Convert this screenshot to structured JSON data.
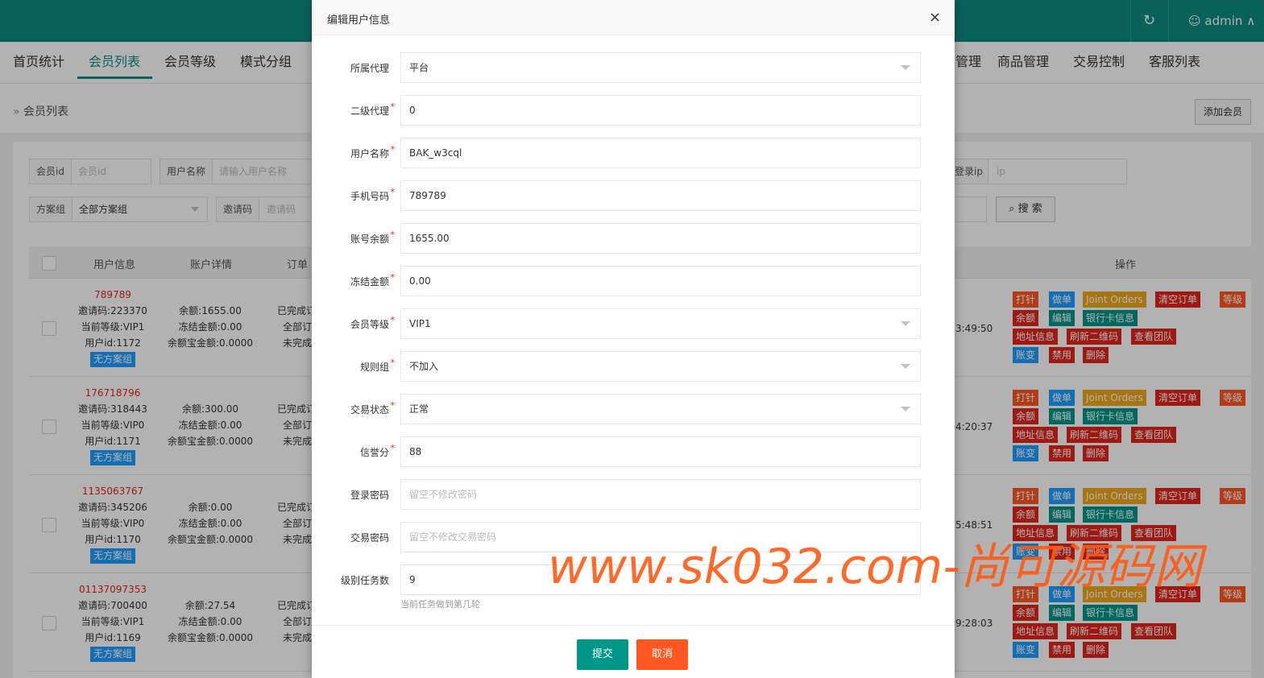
{
  "header": {
    "refresh_icon": "refresh-icon",
    "user": "admin"
  },
  "nav": {
    "items": [
      "首页统计",
      "会员列表",
      "会员等级",
      "模式分组",
      "管理",
      "商品管理",
      "交易控制",
      "客服列表"
    ]
  },
  "breadcrumb": {
    "sep": "»",
    "text": "会员列表",
    "add_button": "添加会员"
  },
  "filters": {
    "member_id": {
      "label": "会员id",
      "placeholder": "会员id"
    },
    "username": {
      "label": "用户名称",
      "placeholder": "请输入用户名称"
    },
    "login_ip": {
      "label": "登录ip",
      "placeholder": "ip"
    },
    "plan_group": {
      "label": "方案组",
      "value": "全部方案组"
    },
    "invite": {
      "label": "邀请码",
      "placeholder": "邀请码"
    },
    "search_button": "搜 索"
  },
  "table": {
    "headers": {
      "user": "用户信息",
      "account": "账户详情",
      "order": "订单",
      "ops": "操作"
    },
    "rows": [
      {
        "phone": "789789",
        "invite": "邀请码:223370",
        "level": "当前等级:VIP1",
        "uid": "用户id:1172",
        "tag": "无方案组",
        "balance": "余额:1655.00",
        "frozen": "冻结金额:0.00",
        "yeb": "余额宝金额:0.0000",
        "o1": "已完成订",
        "o2": "全部订",
        "o3": "未完成",
        "time": "3:49:50"
      },
      {
        "phone": "176718796",
        "invite": "邀请码:318443",
        "level": "当前等级:VIP0",
        "uid": "用户id:1171",
        "tag": "无方案组",
        "balance": "余额:300.00",
        "frozen": "冻结金额:0.00",
        "yeb": "余额宝金额:0.0000",
        "o1": "已完成订",
        "o2": "全部订",
        "o3": "未完成",
        "time": "4:20:37"
      },
      {
        "phone": "1135063767",
        "invite": "邀请码:345206",
        "level": "当前等级:VIP0",
        "uid": "用户id:1170",
        "tag": "无方案组",
        "balance": "余额:0.00",
        "frozen": "冻结金额:0.00",
        "yeb": "余额宝金额:0.0000",
        "o1": "已完成订",
        "o2": "全部订",
        "o3": "未完成",
        "time": "5:48:51"
      },
      {
        "phone": "01137097353",
        "invite": "邀请码:700400",
        "level": "当前等级:VIP1",
        "uid": "用户id:1169",
        "tag": "无方案组",
        "balance": "余额:27.54",
        "frozen": "冻结金额:0.00",
        "yeb": "余额宝金额:0.0000",
        "o1": "已完成订",
        "o2": "全部订",
        "o3": "未完成",
        "time": "9:28:03"
      }
    ],
    "ops": {
      "dazhen": "打针",
      "zuodan": "做单",
      "joint": "Joint Orders",
      "clear": "清空订单",
      "level": "等级",
      "balance": "余额",
      "edit": "编辑",
      "bank": "银行卡信息",
      "address": "地址信息",
      "qr": "刷新二维码",
      "team": "查看团队",
      "acct": "账变",
      "ban": "禁用",
      "del": "删除"
    }
  },
  "modal": {
    "title": "编辑用户信息",
    "close": "×",
    "fields": [
      {
        "label": "所属代理",
        "value": "平台",
        "required": false,
        "select": true,
        "placeholder": false
      },
      {
        "label": "二级代理",
        "value": "0",
        "required": true,
        "select": false,
        "placeholder": false
      },
      {
        "label": "用户名称",
        "value": "BAK_w3cql",
        "required": true,
        "select": false,
        "placeholder": false
      },
      {
        "label": "手机号码",
        "value": "789789",
        "required": true,
        "select": false,
        "placeholder": false
      },
      {
        "label": "账号余额",
        "value": "1655.00",
        "required": true,
        "select": false,
        "placeholder": false
      },
      {
        "label": "冻结金额",
        "value": "0.00",
        "required": true,
        "select": false,
        "placeholder": false
      },
      {
        "label": "会员等级",
        "value": "VIP1",
        "required": true,
        "select": true,
        "placeholder": false
      },
      {
        "label": "规则组",
        "value": "不加入",
        "required": true,
        "select": true,
        "placeholder": false
      },
      {
        "label": "交易状态",
        "value": "正常",
        "required": true,
        "select": true,
        "placeholder": false
      },
      {
        "label": "信誉分",
        "value": "88",
        "required": true,
        "select": false,
        "placeholder": false
      },
      {
        "label": "登录密码",
        "value": "留空不修改密码",
        "required": false,
        "select": false,
        "placeholder": true
      },
      {
        "label": "交易密码",
        "value": "留空不修改交易密码",
        "required": false,
        "select": false,
        "placeholder": true
      },
      {
        "label": "级别任务数",
        "value": "9",
        "required": false,
        "select": false,
        "placeholder": false
      }
    ],
    "hint": "当前任务做到第几轮",
    "submit": "提交",
    "cancel": "取消"
  },
  "watermark": "www.sk032.com-尚可源码网",
  "colors": {
    "primary": "#0d8b85",
    "danger": "#ff5722",
    "blue": "#1e9fff",
    "red": "#e1251b",
    "yellow": "#f0a81a"
  }
}
